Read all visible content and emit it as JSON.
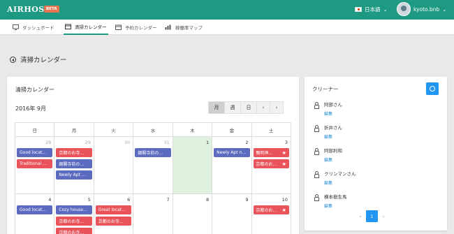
{
  "app": {
    "logo": "AIRHOST",
    "badge": "BETA",
    "language": "日本語",
    "username": "kyoto.bnb"
  },
  "nav": [
    {
      "label": "ダッシュボード",
      "icon": "monitor-icon"
    },
    {
      "label": "清掃カレンダー",
      "icon": "calendar-icon"
    },
    {
      "label": "予約カレンダー",
      "icon": "calendar-icon"
    },
    {
      "label": "稼働率マップ",
      "icon": "bar-chart-icon"
    }
  ],
  "page": {
    "title": "清掃カレンダー"
  },
  "calendar": {
    "title": "清掃カレンダー",
    "month": "2016年 9月",
    "views": [
      "月",
      "週",
      "日"
    ],
    "prev": "‹",
    "next": "›",
    "weekdays": [
      "日",
      "月",
      "火",
      "水",
      "木",
      "金",
      "土"
    ],
    "weeks": [
      [
        {
          "num": "28",
          "other": true,
          "events": [
            {
              "text": "Good locat…",
              "color": "blue"
            },
            {
              "text": "Traditional …",
              "color": "red"
            }
          ]
        },
        {
          "num": "29",
          "other": true,
          "events": [
            {
              "text": "京都のお寺…",
              "color": "red"
            },
            {
              "text": "銀閣寺前の…",
              "color": "blue"
            },
            {
              "text": "Newly Apt …",
              "color": "blue"
            }
          ]
        },
        {
          "num": "30",
          "other": true,
          "events": []
        },
        {
          "num": "31",
          "other": true,
          "events": [
            {
              "text": "銀閣寺前の…",
              "color": "blue"
            }
          ]
        },
        {
          "num": "1",
          "today": true,
          "events": []
        },
        {
          "num": "2",
          "events": [
            {
              "text": "Newly Apt n…",
              "color": "blue"
            }
          ]
        },
        {
          "num": "3",
          "events": [
            {
              "text": "鴨明神…",
              "color": "red",
              "star": true
            },
            {
              "text": "京都のお…",
              "color": "red",
              "star": true
            }
          ]
        }
      ],
      [
        {
          "num": "4",
          "events": [
            {
              "text": "Good locat…",
              "color": "blue"
            }
          ]
        },
        {
          "num": "5",
          "events": [
            {
              "text": "Cozy house…",
              "color": "blue"
            },
            {
              "text": "京都のお寺…",
              "color": "red"
            },
            {
              "text": "京都のお寺…",
              "color": "red"
            }
          ]
        },
        {
          "num": "6",
          "events": [
            {
              "text": "Great locat…",
              "color": "red"
            },
            {
              "text": "京都のお寺…",
              "color": "red"
            }
          ]
        },
        {
          "num": "7",
          "events": []
        },
        {
          "num": "8",
          "events": []
        },
        {
          "num": "9",
          "events": []
        },
        {
          "num": "10",
          "events": [
            {
              "text": "京都のお…",
              "color": "red",
              "star": true
            }
          ]
        }
      ]
    ]
  },
  "cleaners": {
    "title": "クリーナー",
    "edit_label": "編集",
    "list": [
      {
        "name": "阿部さん"
      },
      {
        "name": "折井さん"
      },
      {
        "name": "阿部利和"
      },
      {
        "name": "クリンマンさん"
      },
      {
        "name": "横本樹生馬"
      }
    ],
    "pager": {
      "prev": "«",
      "current": "1",
      "next": "»"
    }
  },
  "colors": {
    "brand": "#1e9a82",
    "badge": "#e8754f",
    "event_blue": "#5c6bc0",
    "event_red": "#e9545b",
    "primary": "#2196f3",
    "today": "#dff1df"
  }
}
